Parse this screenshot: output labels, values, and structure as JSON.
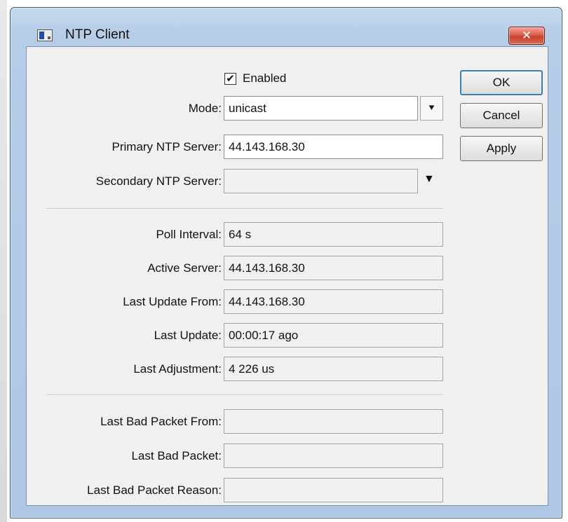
{
  "window": {
    "title": "NTP Client",
    "close_label": "✕"
  },
  "settings": {
    "enabled_label": "Enabled",
    "enabled_checked": true,
    "check_glyph": "✔",
    "mode_label": "Mode:",
    "mode_value": "unicast",
    "primary_label": "Primary NTP Server:",
    "primary_value": "44.143.168.30",
    "secondary_label": "Secondary NTP Server:",
    "secondary_value": ""
  },
  "status": {
    "poll_interval_label": "Poll Interval:",
    "poll_interval_value": "64 s",
    "active_server_label": "Active Server:",
    "active_server_value": "44.143.168.30",
    "last_update_from_label": "Last Update From:",
    "last_update_from_value": "44.143.168.30",
    "last_update_label": "Last Update:",
    "last_update_value": "00:00:17 ago",
    "last_adjustment_label": "Last Adjustment:",
    "last_adjustment_value": "4 226 us"
  },
  "bad_packet": {
    "from_label": "Last Bad Packet From:",
    "from_value": "",
    "packet_label": "Last Bad Packet:",
    "packet_value": "",
    "reason_label": "Last Bad Packet Reason:",
    "reason_value": ""
  },
  "buttons": {
    "ok": "OK",
    "cancel": "Cancel",
    "apply": "Apply"
  },
  "icons": {
    "mode_dropdown": "dropdown-arrow-icon",
    "secondary_dropdown": "dropdown-arrow-icon",
    "app": "window-app-icon"
  },
  "colors": {
    "frame": "#b6cde8",
    "client": "#f0f0f0",
    "close": "#c8412e"
  }
}
